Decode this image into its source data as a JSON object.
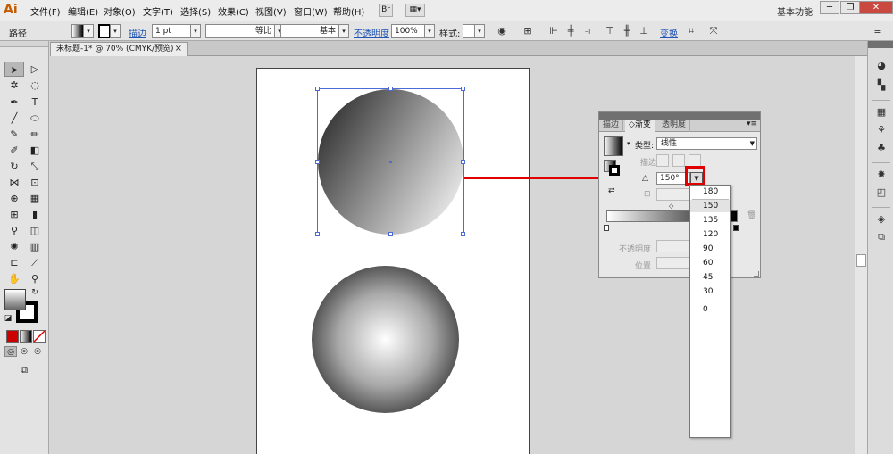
{
  "app": {
    "logo": "Ai",
    "workspace": "基本功能"
  },
  "menu": [
    "文件(F)",
    "编辑(E)",
    "对象(O)",
    "文字(T)",
    "选择(S)",
    "效果(C)",
    "视图(V)",
    "窗口(W)",
    "帮助(H)"
  ],
  "menu_chips": {
    "bridge": "Br",
    "arrange": "▦▾"
  },
  "window_buttons": {
    "minimize": "─",
    "restore": "❐",
    "close": "✕"
  },
  "control": {
    "object_type": "路径",
    "stroke_link": "描边",
    "stroke_weight": "1 pt",
    "stroke_profile": "等比",
    "brush_style": "基本",
    "opacity_link": "不透明度",
    "opacity_value": "100%",
    "style_label": "样式:",
    "transform_link": "变换"
  },
  "document": {
    "tab_title": "未标题-1* @ 70% (CMYK/预览)",
    "close": "×"
  },
  "panel": {
    "tabs": [
      "描边",
      "◇渐变",
      "透明度"
    ],
    "type_label": "类型:",
    "type_value": "线性",
    "stroke_label": "描边",
    "angle_value": "150°",
    "opacity_label": "不透明度",
    "location_label": "位置"
  },
  "angle_options": [
    "180",
    "150",
    "135",
    "120",
    "90",
    "60",
    "45",
    "30",
    "0"
  ],
  "selected_angle": "150",
  "colors": {
    "highlight": "#e00000",
    "selection": "#4d6bd6"
  }
}
